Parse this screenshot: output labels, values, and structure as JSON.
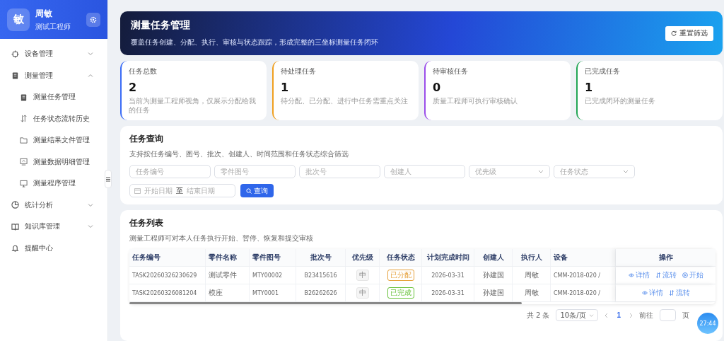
{
  "user": {
    "avatar_char": "敏",
    "name": "周敏",
    "role": "测试工程师"
  },
  "sidebar": {
    "items": [
      {
        "label": "设备管理",
        "expanded": false
      },
      {
        "label": "测量管理",
        "expanded": true,
        "children": [
          {
            "label": "测量任务管理"
          },
          {
            "label": "任务状态流转历史"
          },
          {
            "label": "测量结果文件管理"
          },
          {
            "label": "测量数据明细管理"
          },
          {
            "label": "测量程序管理"
          }
        ]
      },
      {
        "label": "统计分析",
        "expanded": false
      },
      {
        "label": "知识库管理",
        "expanded": false
      },
      {
        "label": "提醒中心"
      }
    ]
  },
  "hero": {
    "title": "测量任务管理",
    "subtitle": "覆盖任务创建、分配、执行、审核与状态跟踪，形成完整的三坐标测量任务闭环",
    "button": "重置筛选"
  },
  "stats": [
    {
      "label": "任务总数",
      "value": "2",
      "note": "当前为测量工程师视角，仅展示分配给我的任务",
      "color": "#3b6cf6"
    },
    {
      "label": "待处理任务",
      "value": "1",
      "note": "待分配、已分配、进行中任务需重点关注",
      "color": "#f0a020"
    },
    {
      "label": "待审核任务",
      "value": "0",
      "note": "质量工程师可执行审核确认",
      "color": "#9b4dea"
    },
    {
      "label": "已完成任务",
      "value": "1",
      "note": "已完成闭环的测量任务",
      "color": "#22a655"
    }
  ],
  "query": {
    "title": "任务查询",
    "description": "支持按任务编号、图号、批次、创建人、时间范围和任务状态综合筛选",
    "fields": [
      {
        "kind": "input",
        "placeholder": "任务编号"
      },
      {
        "kind": "input",
        "placeholder": "零件图号"
      },
      {
        "kind": "input",
        "placeholder": "批次号"
      },
      {
        "kind": "input",
        "placeholder": "创建人"
      },
      {
        "kind": "select",
        "placeholder": "优先级"
      },
      {
        "kind": "select",
        "placeholder": "任务状态"
      }
    ],
    "date_range": {
      "start_placeholder": "开始日期",
      "separator": "至",
      "end_placeholder": "结束日期"
    },
    "button": "查询"
  },
  "table": {
    "title": "任务列表",
    "description": "测量工程师可对本人任务执行开始、暂停、恢复和提交审核",
    "columns": [
      "任务编号",
      "零件名称",
      "零件图号",
      "批次号",
      "优先级",
      "任务状态",
      "计划完成时间",
      "创建人",
      "执行人",
      "设备",
      "操作"
    ],
    "rows": [
      {
        "task_no": "TASK20260326230629",
        "part_name": "测试零件",
        "drawing_no": "MTY00002",
        "batch": "B23415616",
        "priority": "中",
        "status": {
          "label": "已分配",
          "color": "#e6a23c"
        },
        "due": "2026-03-31",
        "creator": "孙建国",
        "executor": "周敏",
        "device": "CMM-2018-020 /",
        "actions": [
          {
            "kind": "view",
            "label": "详情"
          },
          {
            "kind": "flow",
            "label": "流转"
          },
          {
            "kind": "start",
            "label": "开始"
          }
        ]
      },
      {
        "task_no": "TASK20260326081204",
        "part_name": "模座",
        "drawing_no": "MTY0001",
        "batch": "B26262626",
        "priority": "中",
        "status": {
          "label": "已完成",
          "color": "#67c23a"
        },
        "due": "2026-03-31",
        "creator": "孙建国",
        "executor": "周敏",
        "device": "CMM-2018-020 /",
        "actions": [
          {
            "kind": "view",
            "label": "详情"
          },
          {
            "kind": "flow",
            "label": "流转"
          }
        ]
      }
    ]
  },
  "pagination": {
    "total": "共 2 条",
    "page_size": "10条/页",
    "pages": [
      {
        "label": "1",
        "selected": true
      }
    ],
    "goto": "前往",
    "page_unit": "页"
  },
  "timer_badge": "27:44"
}
